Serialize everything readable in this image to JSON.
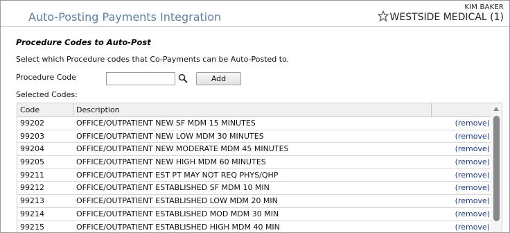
{
  "header": {
    "title": "Auto-Posting Payments Integration",
    "user_name": "KIM BAKER",
    "practice_name": "WESTSIDE MEDICAL (1)"
  },
  "section": {
    "title": "Procedure Codes to Auto-Post",
    "instruction": "Select which Procedure codes that Co-Payments can be Auto-Posted to.",
    "procedure_label": "Procedure Code",
    "procedure_value": "",
    "add_label": "Add",
    "selected_label": "Selected Codes:"
  },
  "table": {
    "columns": {
      "code": "Code",
      "description": "Description",
      "action": ""
    },
    "rows": [
      {
        "code": "99202",
        "description": "OFFICE/OUTPATIENT NEW SF MDM 15 MINUTES",
        "action": "(remove)"
      },
      {
        "code": "99203",
        "description": "OFFICE/OUTPATIENT NEW LOW MDM 30 MINUTES",
        "action": "(remove)"
      },
      {
        "code": "99204",
        "description": "OFFICE/OUTPATIENT NEW MODERATE MDM 45 MINUTES",
        "action": "(remove)"
      },
      {
        "code": "99205",
        "description": "OFFICE/OUTPATIENT NEW HIGH MDM 60 MINUTES",
        "action": "(remove)"
      },
      {
        "code": "99211",
        "description": "OFFICE/OUTPATIENT EST PT MAY NOT REQ PHYS/QHP",
        "action": "(remove)"
      },
      {
        "code": "99212",
        "description": "OFFICE/OUTPATIENT ESTABLISHED SF MDM 10 MIN",
        "action": "(remove)"
      },
      {
        "code": "99213",
        "description": "OFFICE/OUTPATIENT ESTABLISHED LOW MDM 20 MIN",
        "action": "(remove)"
      },
      {
        "code": "99214",
        "description": "OFFICE/OUTPATIENT ESTABLISHED MOD MDM 30 MIN",
        "action": "(remove)"
      },
      {
        "code": "99215",
        "description": "OFFICE/OUTPATIENT ESTABLISHED HIGH MDM 40 MIN",
        "action": "(remove)"
      }
    ]
  },
  "icons": {
    "favorite": "star-outline-icon",
    "search": "magnifier-icon"
  },
  "colors": {
    "title": "#5b7fa6",
    "link": "#1f3f8f"
  }
}
